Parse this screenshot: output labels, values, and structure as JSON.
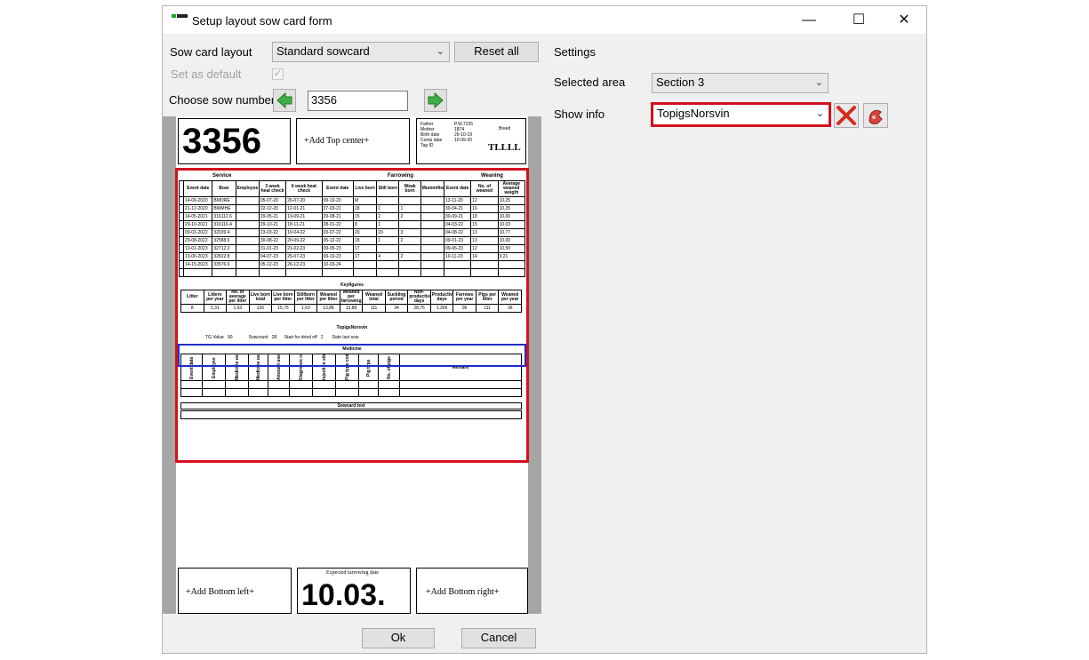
{
  "window": {
    "title": "Setup layout sow card form",
    "minimize": "—",
    "maximize": "☐",
    "close": "✕"
  },
  "left": {
    "layout_label": "Sow card layout",
    "layout_value": "Standard sowcard",
    "reset_label": "Reset all",
    "default_label": "Set as default",
    "default_mark": "✓",
    "sow_label": "Choose sow number",
    "sow_number": "3356"
  },
  "settings": {
    "heading": "Settings",
    "area_label": "Selected area",
    "area_value": "Section 3",
    "info_label": "Show info",
    "info_value": "TopigsNorsvin"
  },
  "card": {
    "big_number": "3356",
    "top_center": "+Add Top center+",
    "info_labels": [
      "Father",
      "Mother",
      "Birth date",
      "Comp date",
      "Tag ID"
    ],
    "info_values": [
      "P.W.7226",
      "1874",
      "26-10-19",
      "10-09-20",
      ""
    ],
    "info_right_label": "Breed",
    "info_right_value": "TLLLL",
    "service_header": "Service",
    "farrowing_header": "Farrowing",
    "weaning_header": "Weaning",
    "col_heads": [
      "Event date",
      "Boar",
      "Employee",
      "3 week heat check",
      "6 week heat check",
      "Event date",
      "Live born",
      "Still born",
      "Weak born",
      "Mummified",
      "Event date",
      "No. of weaned",
      "Average weaned weight"
    ],
    "rows": [
      [
        "14-09-2020",
        "BMORE",
        "",
        "05-07-20",
        "26-07-20",
        "09-10-20",
        "M",
        "",
        "",
        "",
        "13-11-20",
        "12",
        "10,25"
      ],
      [
        "21-12-2020",
        "BWMHE",
        "",
        "22-12-20",
        "12-01-21",
        "27-03-21",
        "18",
        "1",
        "1",
        "",
        "30-04-21",
        "16",
        "10,25"
      ],
      [
        "14-05-2021",
        "316112.6",
        "",
        "29-05-21",
        "19-09-21",
        "29-08-21",
        "15",
        "2",
        "2",
        "",
        "30-09-21",
        "18",
        "10,00"
      ],
      [
        "29-10-2021",
        "316116.4",
        "",
        "29-10-21",
        "18-11-21",
        "28-01-22",
        "8",
        "1",
        "",
        "",
        "04-03-22",
        "15",
        "10,03"
      ],
      [
        "09-03-2022",
        "32039.4",
        "",
        "23-03-22",
        "10-04-22",
        "03-07-22",
        "20",
        "20",
        "3",
        "",
        "04-08-22",
        "13",
        "10,77"
      ],
      [
        "29-08-2022",
        "32588.6",
        "",
        "30-08-22",
        "20-09-22",
        "05-12-22",
        "18",
        "1",
        "2",
        "",
        "09-01-23",
        "13",
        "10,00"
      ],
      [
        "10-01-2023",
        "32712.2",
        "",
        "31-01-23",
        "21-02-23",
        "09-05-23",
        "17",
        "",
        "",
        "",
        "09-06-23",
        "12",
        "10,50"
      ],
      [
        "13-06-2023",
        "32822.8",
        "",
        "04-07-23",
        "25-07-23",
        "09-10-23",
        "17",
        "4",
        "2",
        "",
        "10-11-23",
        "14",
        "9,21"
      ],
      [
        "14-15-2023",
        "33576.6",
        "",
        "05-12-23",
        "26-12-23",
        "10-03-24",
        "",
        "",
        "",
        "",
        "",
        "",
        ""
      ]
    ],
    "keyfigures_header": "Keyfigures",
    "kf_heads": [
      "Litter",
      "Litters per year",
      "No. of average per litter",
      "Live born total",
      "Live born per litter",
      "Stillborn per litter",
      "Weaned per litter",
      "Weaned per farrowing",
      "Weaned total",
      "Suckling period",
      "Non-productive days",
      "Productive days",
      "Farrows per year",
      "Pigs per litter",
      "Weaned per year"
    ],
    "kf_values": [
      "8",
      "2,31",
      "1,93",
      "126",
      "15,75",
      "1,63",
      "13,88",
      "13,88",
      "111",
      "34",
      "28,75",
      "1.266",
      "96",
      "111",
      "36"
    ],
    "topigs_header": "TopigsNorsvin",
    "topigs_values": [
      "TG Value",
      "90",
      "Sowcount",
      "28",
      "Start for dried off",
      "2",
      "Date last sow"
    ],
    "medicine_header": "Medicine",
    "med_heads": [
      "Event date",
      "Employee",
      "Medicine used",
      "Medicine used",
      "Amount used",
      "Diagnosis code",
      "Injection site",
      "Pig type code",
      "Pig type",
      "No. of pigs",
      "Remark"
    ],
    "sowcard_text_header": "Sowcard text",
    "bottom_left": "+Add Bottom left+",
    "expected_label": "Expected farrowing date",
    "expected_value": "10.03.",
    "bottom_right": "+Add Bottom right+"
  },
  "footer": {
    "ok": "Ok",
    "cancel": "Cancel"
  },
  "colors": {
    "highlight_red": "#d3101c",
    "highlight_blue": "#1f2fc8",
    "nav_arrow_green": "#3cb043"
  }
}
